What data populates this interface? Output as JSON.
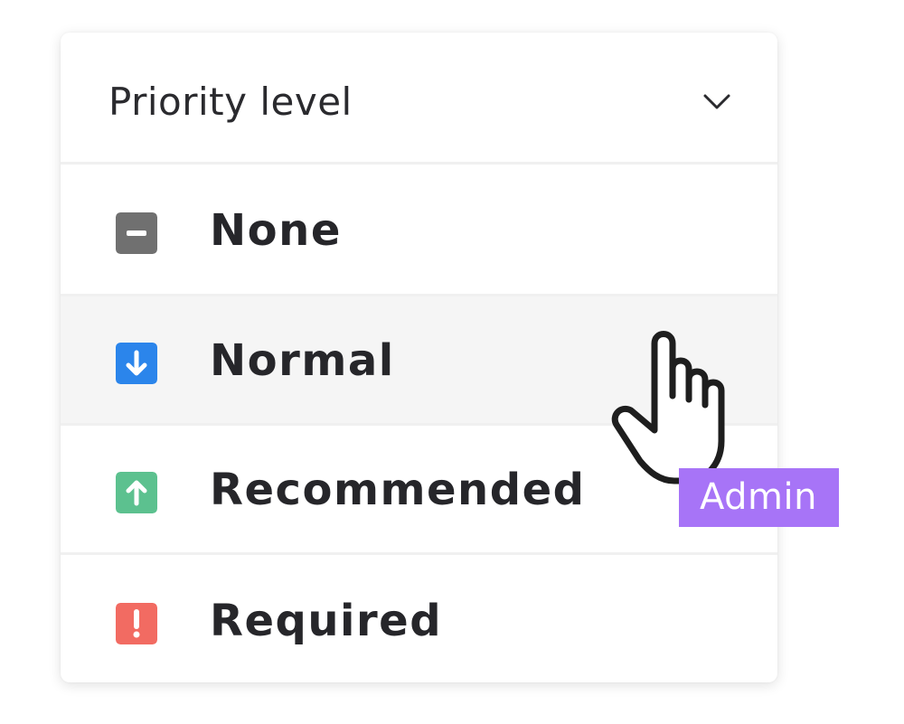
{
  "dropdown": {
    "title": "Priority level",
    "toggle_icon": "chevron-down-icon",
    "options": [
      {
        "label": "None",
        "icon": "minus-icon",
        "color": "#707070",
        "hovered": false
      },
      {
        "label": "Normal",
        "icon": "arrow-down-icon",
        "color": "#2b85eb",
        "hovered": true
      },
      {
        "label": "Recommended",
        "icon": "arrow-up-icon",
        "color": "#5cc18f",
        "hovered": false
      },
      {
        "label": "Required",
        "icon": "exclamation-icon",
        "color": "#f26b62",
        "hovered": false
      }
    ]
  },
  "cursor": {
    "icon": "pointer-hand-icon"
  },
  "admin_tag": {
    "label": "Admin",
    "color": "#a774f7"
  }
}
